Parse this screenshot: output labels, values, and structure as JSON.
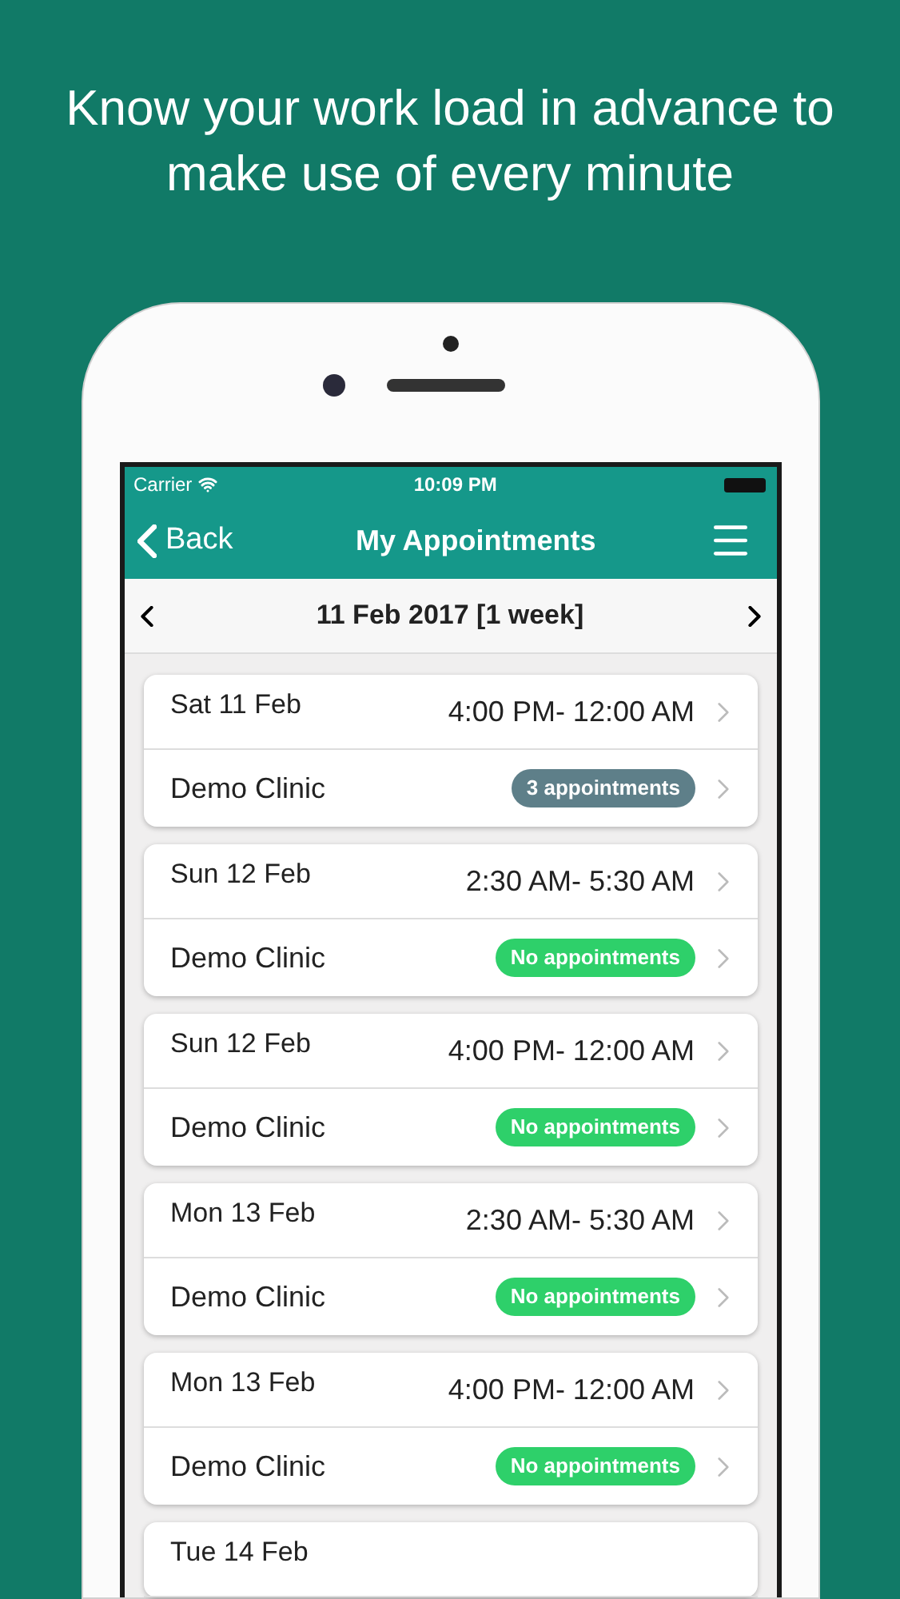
{
  "headline": "Know your work load in advance to make use of every minute",
  "status_bar": {
    "carrier": "Carrier",
    "time": "10:09 PM"
  },
  "nav_bar": {
    "back": "Back",
    "title": "My Appointments"
  },
  "date_bar": {
    "label": "11 Feb 2017 [1 week]"
  },
  "shifts": [
    {
      "date": "Sat 11 Feb",
      "time": "4:00 PM- 12:00 AM",
      "clinic": "Demo Clinic",
      "badge": "3 appointments",
      "color": "#5e7f89"
    },
    {
      "date": "Sun 12 Feb",
      "time": "2:30 AM- 5:30 AM",
      "clinic": "Demo Clinic",
      "badge": "No appointments",
      "color": "#2ed06a"
    },
    {
      "date": "Sun 12 Feb",
      "time": "4:00 PM- 12:00 AM",
      "clinic": "Demo Clinic",
      "badge": "No appointments",
      "color": "#2ed06a"
    },
    {
      "date": "Mon 13 Feb",
      "time": "2:30 AM- 5:30 AM",
      "clinic": "Demo Clinic",
      "badge": "No appointments",
      "color": "#2ed06a"
    },
    {
      "date": "Mon 13 Feb",
      "time": "4:00 PM- 12:00 AM",
      "clinic": "Demo Clinic",
      "badge": "No appointments",
      "color": "#2ed06a"
    },
    {
      "date": "Tue 14 Feb"
    }
  ]
}
